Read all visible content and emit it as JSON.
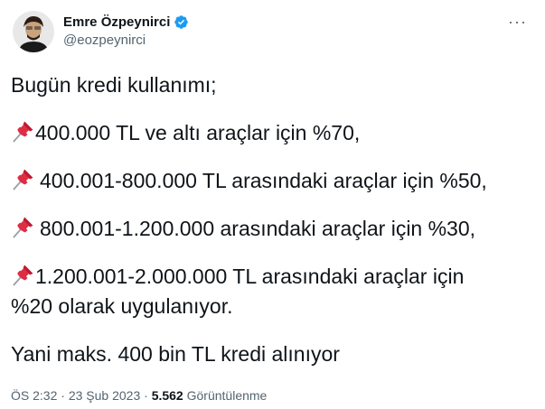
{
  "author": {
    "display_name": "Emre Özpeynirci",
    "handle": "@eozpeynirci",
    "verified_icon": "verified-badge-icon",
    "badge_color": "#1d9bf0"
  },
  "tweet": {
    "lines": [
      "Bugün kredi kullanımı;",
      "400.000 TL ve altı araçlar için %70,",
      "400.001-800.000 TL arasındaki araçlar için %50,",
      "800.001-1.200.000 arasındaki araçlar için %30,",
      "1.200.001-2.000.000 TL arasındaki araçlar için",
      "%20 olarak uygulanıyor.",
      "Yani maks. 400 bin TL kredi alınıyor"
    ],
    "pin_icon": "pushpin-icon"
  },
  "meta": {
    "time": "ÖS 2:32",
    "separator": " · ",
    "date": "23 Şub 2023",
    "views_count": "5.562",
    "views_label": " Görüntülenme"
  },
  "more_icon": "more-options-icon"
}
